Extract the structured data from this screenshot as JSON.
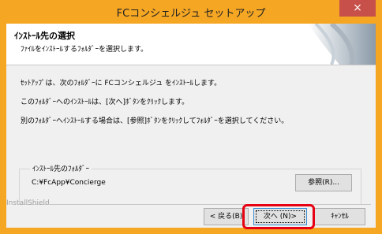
{
  "window": {
    "title": "FCコンシェルジュ セットアップ",
    "close_glyph": "×",
    "title_bar_color": "#f5a623",
    "close_color": "#c7504a"
  },
  "header": {
    "title": "ｲﾝｽﾄｰﾙ先の選択",
    "subtitle": "ﾌｧｲﾙをｲﾝｽﾄｰﾙするﾌｫﾙﾀﾞｰを選択します。"
  },
  "body": {
    "messages": [
      "ｾｯﾄｱｯﾌﾟは、次のﾌｫﾙﾀﾞｰに FCコンシェルジュ をｲﾝｽﾄｰﾙします。",
      "このﾌｫﾙﾀﾞｰへのｲﾝｽﾄｰﾙは、[次へ]ﾎﾞﾀﾝをｸﾘｯｸします。",
      "別のﾌｫﾙﾀﾞｰへｲﾝｽﾄｰﾙする場合は、[参照]ﾎﾞﾀﾝをｸﾘｯｸしてﾌｫﾙﾀﾞｰを選択してください。"
    ]
  },
  "destination": {
    "group_label": "ｲﾝｽﾄｰﾙ先のﾌｫﾙﾀﾞｰ",
    "path": "C:¥FcApp¥Concierge",
    "browse_label": "参照(R)..."
  },
  "footer": {
    "brand": "InstallShield",
    "back_label": "< 戻る(B)",
    "next_label": "次へ (N)>",
    "cancel_label": "ｷｬﾝｾﾙ"
  },
  "annotation": {
    "highlight_color": "#e60012"
  }
}
